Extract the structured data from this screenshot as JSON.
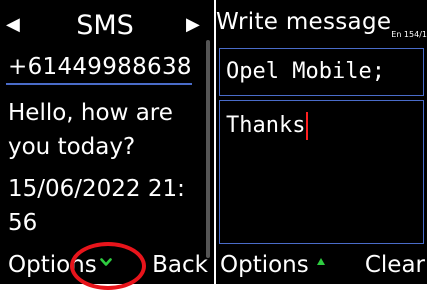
{
  "left_screen": {
    "header": {
      "title": "SMS",
      "prev_icon": "triangle-left-icon",
      "next_icon": "triangle-right-icon"
    },
    "sender_number": "+61449988638",
    "message_lines": [
      "Hello, how are",
      "you today?"
    ],
    "timestamp_lines": [
      "15/06/2022 21:",
      "56"
    ],
    "softkeys": {
      "left": "Options",
      "right": "Back",
      "center_icon": "checkmark-down-icon"
    }
  },
  "right_screen": {
    "title": "Write message",
    "char_counter": "En 154/1",
    "recipient_value": "Opel Mobile;",
    "message_value": "Thanks",
    "softkeys": {
      "left": "Options",
      "right": "Clear",
      "center_icon": "arrow-up-icon"
    }
  },
  "colors": {
    "background": "#000000",
    "text": "#ffffff",
    "field_border": "#4a6cc9",
    "caret": "#ff2020",
    "nav_icon": "#2ecc40",
    "annotation": "#e8141b"
  }
}
